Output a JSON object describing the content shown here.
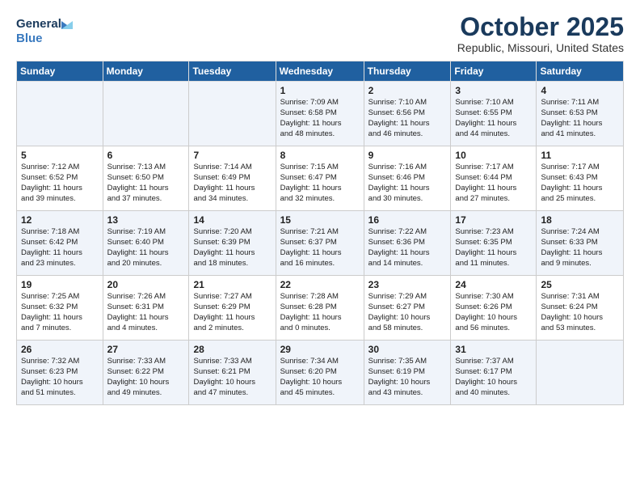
{
  "logo": {
    "line1": "General",
    "line2": "Blue"
  },
  "title": "October 2025",
  "subtitle": "Republic, Missouri, United States",
  "days_of_week": [
    "Sunday",
    "Monday",
    "Tuesday",
    "Wednesday",
    "Thursday",
    "Friday",
    "Saturday"
  ],
  "weeks": [
    [
      {
        "day": "",
        "content": ""
      },
      {
        "day": "",
        "content": ""
      },
      {
        "day": "",
        "content": ""
      },
      {
        "day": "1",
        "content": "Sunrise: 7:09 AM\nSunset: 6:58 PM\nDaylight: 11 hours\nand 48 minutes."
      },
      {
        "day": "2",
        "content": "Sunrise: 7:10 AM\nSunset: 6:56 PM\nDaylight: 11 hours\nand 46 minutes."
      },
      {
        "day": "3",
        "content": "Sunrise: 7:10 AM\nSunset: 6:55 PM\nDaylight: 11 hours\nand 44 minutes."
      },
      {
        "day": "4",
        "content": "Sunrise: 7:11 AM\nSunset: 6:53 PM\nDaylight: 11 hours\nand 41 minutes."
      }
    ],
    [
      {
        "day": "5",
        "content": "Sunrise: 7:12 AM\nSunset: 6:52 PM\nDaylight: 11 hours\nand 39 minutes."
      },
      {
        "day": "6",
        "content": "Sunrise: 7:13 AM\nSunset: 6:50 PM\nDaylight: 11 hours\nand 37 minutes."
      },
      {
        "day": "7",
        "content": "Sunrise: 7:14 AM\nSunset: 6:49 PM\nDaylight: 11 hours\nand 34 minutes."
      },
      {
        "day": "8",
        "content": "Sunrise: 7:15 AM\nSunset: 6:47 PM\nDaylight: 11 hours\nand 32 minutes."
      },
      {
        "day": "9",
        "content": "Sunrise: 7:16 AM\nSunset: 6:46 PM\nDaylight: 11 hours\nand 30 minutes."
      },
      {
        "day": "10",
        "content": "Sunrise: 7:17 AM\nSunset: 6:44 PM\nDaylight: 11 hours\nand 27 minutes."
      },
      {
        "day": "11",
        "content": "Sunrise: 7:17 AM\nSunset: 6:43 PM\nDaylight: 11 hours\nand 25 minutes."
      }
    ],
    [
      {
        "day": "12",
        "content": "Sunrise: 7:18 AM\nSunset: 6:42 PM\nDaylight: 11 hours\nand 23 minutes."
      },
      {
        "day": "13",
        "content": "Sunrise: 7:19 AM\nSunset: 6:40 PM\nDaylight: 11 hours\nand 20 minutes."
      },
      {
        "day": "14",
        "content": "Sunrise: 7:20 AM\nSunset: 6:39 PM\nDaylight: 11 hours\nand 18 minutes."
      },
      {
        "day": "15",
        "content": "Sunrise: 7:21 AM\nSunset: 6:37 PM\nDaylight: 11 hours\nand 16 minutes."
      },
      {
        "day": "16",
        "content": "Sunrise: 7:22 AM\nSunset: 6:36 PM\nDaylight: 11 hours\nand 14 minutes."
      },
      {
        "day": "17",
        "content": "Sunrise: 7:23 AM\nSunset: 6:35 PM\nDaylight: 11 hours\nand 11 minutes."
      },
      {
        "day": "18",
        "content": "Sunrise: 7:24 AM\nSunset: 6:33 PM\nDaylight: 11 hours\nand 9 minutes."
      }
    ],
    [
      {
        "day": "19",
        "content": "Sunrise: 7:25 AM\nSunset: 6:32 PM\nDaylight: 11 hours\nand 7 minutes."
      },
      {
        "day": "20",
        "content": "Sunrise: 7:26 AM\nSunset: 6:31 PM\nDaylight: 11 hours\nand 4 minutes."
      },
      {
        "day": "21",
        "content": "Sunrise: 7:27 AM\nSunset: 6:29 PM\nDaylight: 11 hours\nand 2 minutes."
      },
      {
        "day": "22",
        "content": "Sunrise: 7:28 AM\nSunset: 6:28 PM\nDaylight: 11 hours\nand 0 minutes."
      },
      {
        "day": "23",
        "content": "Sunrise: 7:29 AM\nSunset: 6:27 PM\nDaylight: 10 hours\nand 58 minutes."
      },
      {
        "day": "24",
        "content": "Sunrise: 7:30 AM\nSunset: 6:26 PM\nDaylight: 10 hours\nand 56 minutes."
      },
      {
        "day": "25",
        "content": "Sunrise: 7:31 AM\nSunset: 6:24 PM\nDaylight: 10 hours\nand 53 minutes."
      }
    ],
    [
      {
        "day": "26",
        "content": "Sunrise: 7:32 AM\nSunset: 6:23 PM\nDaylight: 10 hours\nand 51 minutes."
      },
      {
        "day": "27",
        "content": "Sunrise: 7:33 AM\nSunset: 6:22 PM\nDaylight: 10 hours\nand 49 minutes."
      },
      {
        "day": "28",
        "content": "Sunrise: 7:33 AM\nSunset: 6:21 PM\nDaylight: 10 hours\nand 47 minutes."
      },
      {
        "day": "29",
        "content": "Sunrise: 7:34 AM\nSunset: 6:20 PM\nDaylight: 10 hours\nand 45 minutes."
      },
      {
        "day": "30",
        "content": "Sunrise: 7:35 AM\nSunset: 6:19 PM\nDaylight: 10 hours\nand 43 minutes."
      },
      {
        "day": "31",
        "content": "Sunrise: 7:37 AM\nSunset: 6:17 PM\nDaylight: 10 hours\nand 40 minutes."
      },
      {
        "day": "",
        "content": ""
      }
    ]
  ]
}
